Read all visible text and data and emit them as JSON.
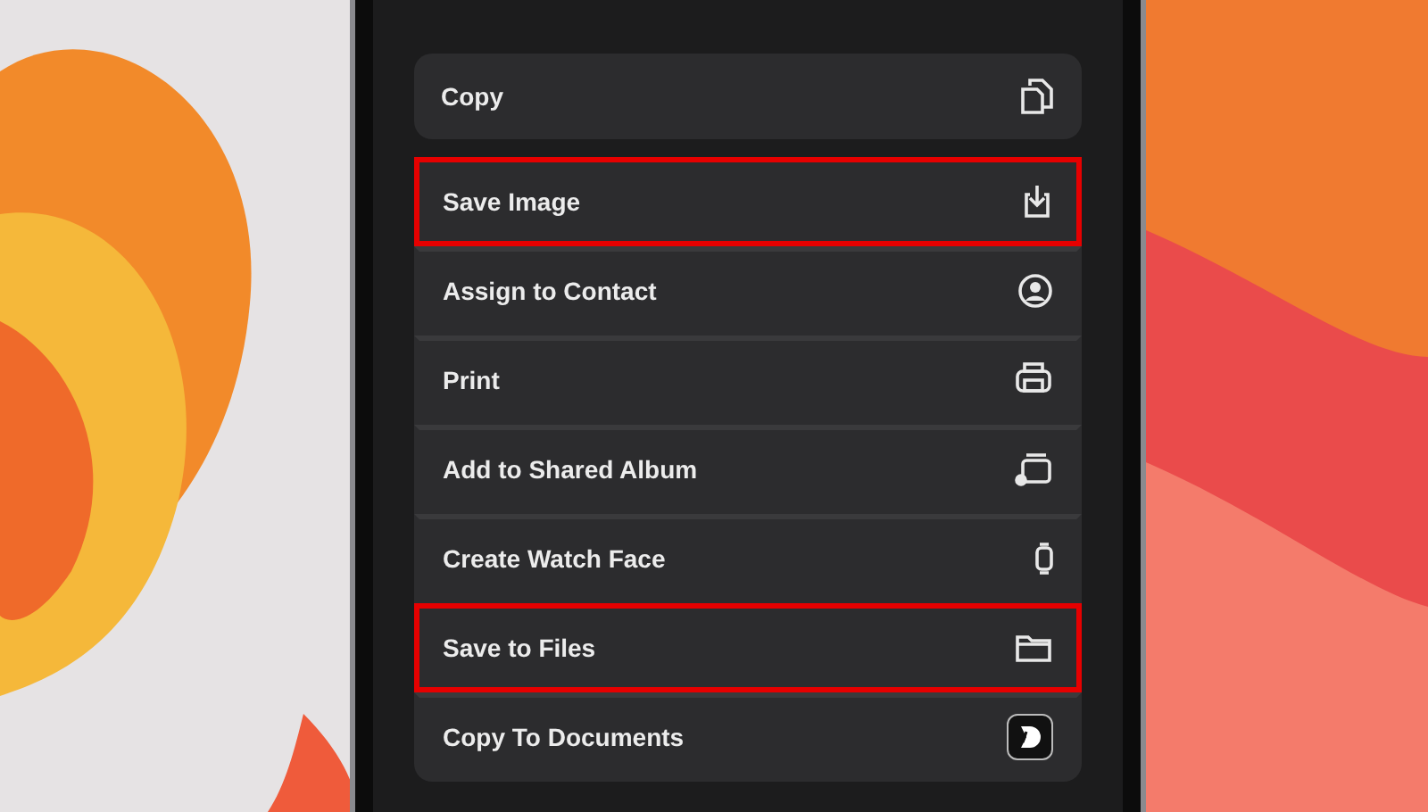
{
  "top_action": {
    "label": "Copy"
  },
  "actions": [
    {
      "label": "Save Image",
      "highlighted": true
    },
    {
      "label": "Assign to Contact",
      "highlighted": false
    },
    {
      "label": "Print",
      "highlighted": false
    },
    {
      "label": "Add to Shared Album",
      "highlighted": false
    },
    {
      "label": "Create Watch Face",
      "highlighted": false
    },
    {
      "label": "Save to Files",
      "highlighted": true
    },
    {
      "label": "Copy To Documents",
      "highlighted": false
    }
  ]
}
